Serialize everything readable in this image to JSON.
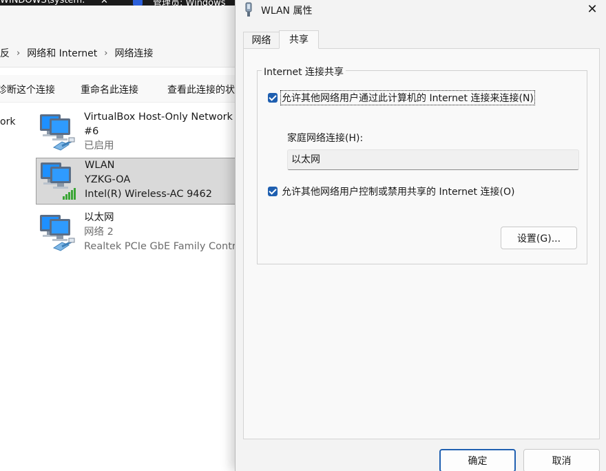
{
  "background_window": {
    "tab_title": "WINDOWS\\system:",
    "tab2_title": "管理员: Windows",
    "breadcrumb": [
      "网络和 Internet",
      "网络连接"
    ],
    "breadcrumb_partial": "反",
    "commands": [
      "诊断这个连接",
      "重命名此连接",
      "查看此连接的状"
    ],
    "nav_partial": "ork",
    "connections": [
      {
        "name": "VirtualBox Host-Only Network",
        "name_line2": "#6",
        "status": "已启用",
        "icon": "ethernet-adapter-icon"
      },
      {
        "name": "WLAN",
        "status": "YZKG-OA",
        "adapter": "Intel(R) Wireless-AC 9462",
        "icon": "wireless-adapter-icon",
        "selected": true
      },
      {
        "name": "以太网",
        "status": "网络 2",
        "adapter": "Realtek PCIe GbE Family Contr",
        "icon": "ethernet-adapter-icon"
      }
    ]
  },
  "dialog": {
    "title": "WLAN 属性",
    "close_glyph": "✕",
    "tabs": [
      {
        "label": "网络",
        "active": false
      },
      {
        "label": "共享",
        "active": true
      }
    ],
    "group_title": "Internet 连接共享",
    "checkbox1": {
      "label": "允许其他网络用户通过此计算机的 Internet 连接来连接(N)",
      "checked": true
    },
    "home_network_label": "家庭网络连接(H):",
    "home_network_value": "以太网",
    "checkbox2": {
      "label": "允许其他网络用户控制或禁用共享的 Internet 连接(O)",
      "checked": true
    },
    "settings_button": "设置(G)...",
    "ok_button": "确定",
    "cancel_button": "取消"
  },
  "colors": {
    "accent": "#1f5fb0",
    "dialog_bg": "#f3f3f3",
    "selection_bg": "#d9d9d9"
  }
}
